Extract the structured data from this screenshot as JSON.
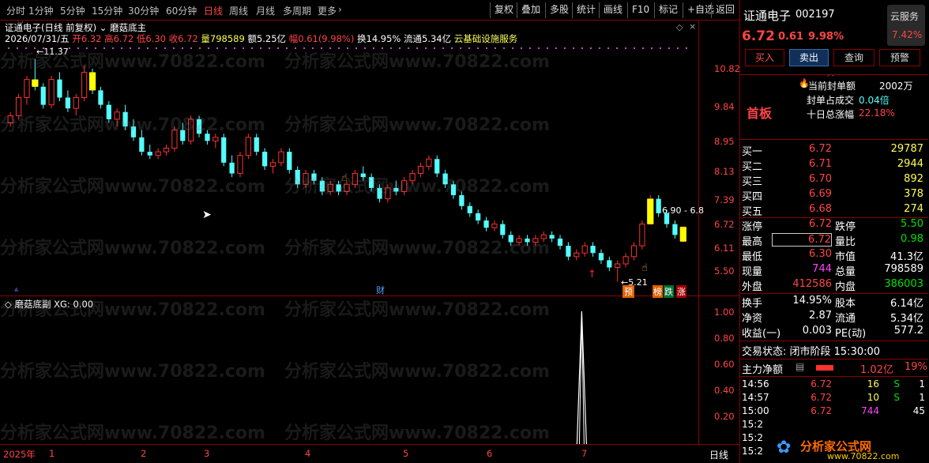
{
  "toolbar": {
    "periods": [
      "分时",
      "1分钟",
      "5分钟",
      "15分钟",
      "30分钟",
      "60分钟",
      "日线",
      "周线",
      "月线",
      "多周期",
      "更多"
    ],
    "active_period": "日线",
    "buttons": [
      "复权",
      "叠加",
      "多股",
      "统计",
      "画线",
      "F10",
      "标记",
      "+自选",
      "返回"
    ]
  },
  "main": {
    "title": "证通电子(日线 前复权)",
    "indicator": "磨菇底主",
    "date": "2026/07/31/五",
    "open_label": "开",
    "open": "6.32",
    "high_label": "高",
    "high": "6.72",
    "low_label": "低",
    "low": "6.30",
    "close_label": "收",
    "close": "6.72",
    "vol_label": "量",
    "vol": "798589",
    "amount_label": "额",
    "amount": "5.25亿",
    "range_label": "幅",
    "range": "0.61(9.98%)",
    "turnover_label": "换",
    "turnover": "14.95%",
    "float_label": "流通",
    "float": "5.34亿",
    "concept": "云基础设施服务",
    "price_ticks": [
      "10.82",
      "9.84",
      "8.95",
      "8.13",
      "7.39",
      "6.72",
      "6.11",
      "5.50"
    ],
    "high_note": "11.37",
    "low_note": "5.21",
    "last_note": "6.90 - 6.8",
    "marker_cai": "财",
    "marker_yu": "预",
    "marker_bang": "榜",
    "marker_die": "跌",
    "marker_zhang": "涨"
  },
  "sub": {
    "title": "磨菇底副",
    "xg": "XG: 0.00",
    "ticks": [
      "1.00",
      "0.80",
      "0.60",
      "0.40",
      "0.20"
    ]
  },
  "xaxis": {
    "labels": [
      "2025年",
      "1",
      "2",
      "3",
      "4",
      "5",
      "6",
      "7"
    ],
    "mode": "日线"
  },
  "watermark": "分析家公式网www.70822.com",
  "panel": {
    "name": "证通电子",
    "code": "002197",
    "cloud": "云服务",
    "cloud_pct": "7.42%",
    "price": "6.72",
    "change": "0.61",
    "pct": "9.98%",
    "btn_buy": "买入",
    "btn_sell": "卖出",
    "btn_query": "查询",
    "btn_alert": "预警",
    "board": "首板",
    "seal_label": "当前封单额",
    "seal": "2002万",
    "seal_ratio_label": "封单占成交",
    "seal_ratio": "0.04倍",
    "ten_label": "十日总涨幅",
    "ten": "22.18%",
    "bids": [
      {
        "label": "买一",
        "price": "6.72",
        "vol": "29787"
      },
      {
        "label": "买二",
        "price": "6.71",
        "vol": "2944"
      },
      {
        "label": "买三",
        "price": "6.70",
        "vol": "892"
      },
      {
        "label": "买四",
        "price": "6.69",
        "vol": "378"
      },
      {
        "label": "买五",
        "price": "6.68",
        "vol": "274"
      }
    ],
    "stats": [
      {
        "l1": "涨停",
        "v1": "6.72",
        "l2": "跌停",
        "v2": "5.50"
      },
      {
        "l1": "最高",
        "v1": "6.72",
        "l2": "量比",
        "v2": "0.98"
      },
      {
        "l1": "最低",
        "v1": "6.30",
        "l2": "市值",
        "v2": "41.3亿"
      },
      {
        "l1": "现量",
        "v1": "744",
        "l2": "总量",
        "v2": "798589"
      },
      {
        "l1": "外盘",
        "v1": "412586",
        "l2": "内盘",
        "v2": "386003"
      }
    ],
    "stats2": [
      {
        "l1": "换手",
        "v1": "14.95%",
        "l2": "股本",
        "v2": "6.14亿"
      },
      {
        "l1": "净资",
        "v1": "2.87",
        "l2": "流通",
        "v2": "5.34亿"
      },
      {
        "l1": "收益(一)",
        "v1": "0.003",
        "l2": "PE(动)",
        "v2": "577.2"
      }
    ],
    "trade_state": "交易状态: 闭市阶段 15:30:00",
    "main_net_label": "主力净额",
    "main_net": "1.02亿",
    "main_net_pct": "19%",
    "ticks": [
      {
        "time": "14:56",
        "price": "6.72",
        "vol": "16",
        "side": "S",
        "n": "1"
      },
      {
        "time": "14:57",
        "price": "6.72",
        "vol": "10",
        "side": "S",
        "n": "1"
      },
      {
        "time": "15:00",
        "price": "6.72",
        "vol": "744",
        "side": "",
        "n": "45"
      },
      {
        "time": "15:2",
        "price": "",
        "vol": "",
        "side": "",
        "n": ""
      },
      {
        "time": "15:2",
        "price": "",
        "vol": "",
        "side": "",
        "n": ""
      },
      {
        "time": "15:2",
        "price": "",
        "vol": "",
        "side": "",
        "n": ""
      }
    ],
    "logo_text": "分析家公式网",
    "logo_url": "www.70822.com"
  },
  "chart_data": {
    "type": "candlestick",
    "ylim": [
      5.0,
      11.6
    ],
    "candles": [
      [
        9.6,
        9.9,
        9.5,
        9.8
      ],
      [
        9.8,
        10.4,
        9.7,
        10.3
      ],
      [
        10.3,
        10.9,
        10.1,
        10.8
      ],
      [
        10.8,
        11.37,
        10.5,
        10.6
      ],
      [
        10.6,
        10.7,
        10.0,
        10.1
      ],
      [
        10.1,
        10.9,
        10.0,
        10.8
      ],
      [
        10.8,
        11.0,
        10.2,
        10.3
      ],
      [
        10.3,
        10.5,
        9.9,
        10.0
      ],
      [
        10.0,
        10.4,
        9.8,
        10.3
      ],
      [
        10.3,
        11.2,
        10.2,
        11.0
      ],
      [
        11.0,
        11.1,
        10.4,
        10.5
      ],
      [
        10.5,
        10.6,
        10.0,
        10.1
      ],
      [
        10.1,
        10.2,
        9.6,
        9.7
      ],
      [
        9.7,
        10.0,
        9.5,
        9.9
      ],
      [
        9.9,
        10.1,
        9.4,
        9.5
      ],
      [
        9.5,
        9.7,
        9.1,
        9.2
      ],
      [
        9.2,
        9.4,
        8.7,
        8.8
      ],
      [
        8.8,
        9.0,
        8.6,
        8.7
      ],
      [
        8.7,
        8.9,
        8.6,
        8.8
      ],
      [
        8.8,
        9.0,
        8.7,
        8.9
      ],
      [
        8.9,
        9.5,
        8.8,
        9.4
      ],
      [
        9.4,
        9.6,
        9.0,
        9.1
      ],
      [
        9.1,
        9.8,
        9.0,
        9.7
      ],
      [
        9.7,
        9.8,
        9.2,
        9.3
      ],
      [
        9.3,
        9.4,
        9.0,
        9.1
      ],
      [
        9.1,
        9.3,
        8.9,
        9.2
      ],
      [
        9.2,
        9.3,
        8.4,
        8.5
      ],
      [
        8.5,
        8.7,
        8.1,
        8.2
      ],
      [
        8.2,
        8.8,
        8.1,
        8.7
      ],
      [
        8.7,
        9.3,
        8.6,
        9.2
      ],
      [
        9.2,
        9.3,
        8.7,
        8.8
      ],
      [
        8.8,
        8.9,
        8.3,
        8.4
      ],
      [
        8.4,
        8.6,
        8.2,
        8.5
      ],
      [
        8.5,
        8.9,
        8.4,
        8.8
      ],
      [
        8.8,
        8.9,
        8.2,
        8.3
      ],
      [
        8.3,
        8.4,
        7.8,
        7.9
      ],
      [
        7.9,
        8.3,
        7.8,
        8.2
      ],
      [
        8.2,
        8.3,
        7.9,
        8.0
      ],
      [
        8.0,
        8.1,
        7.6,
        7.7
      ],
      [
        7.7,
        8.0,
        7.6,
        7.9
      ],
      [
        7.9,
        8.0,
        7.6,
        7.7
      ],
      [
        7.7,
        8.0,
        7.6,
        7.9
      ],
      [
        7.9,
        8.3,
        7.8,
        8.2
      ],
      [
        8.2,
        8.4,
        8.0,
        8.1
      ],
      [
        8.1,
        8.2,
        7.7,
        7.8
      ],
      [
        7.8,
        7.9,
        7.4,
        7.5
      ],
      [
        7.5,
        7.9,
        7.4,
        7.8
      ],
      [
        7.8,
        8.0,
        7.6,
        7.7
      ],
      [
        7.7,
        8.1,
        7.6,
        8.0
      ],
      [
        8.0,
        8.3,
        7.9,
        8.2
      ],
      [
        8.2,
        8.5,
        8.1,
        8.4
      ],
      [
        8.4,
        8.7,
        8.3,
        8.6
      ],
      [
        8.6,
        8.7,
        8.1,
        8.2
      ],
      [
        8.2,
        8.3,
        7.8,
        7.9
      ],
      [
        7.9,
        8.0,
        7.5,
        7.6
      ],
      [
        7.6,
        7.7,
        7.2,
        7.3
      ],
      [
        7.3,
        7.4,
        7.0,
        7.1
      ],
      [
        7.1,
        7.2,
        6.8,
        6.9
      ],
      [
        6.9,
        7.0,
        6.6,
        6.7
      ],
      [
        6.7,
        6.9,
        6.6,
        6.8
      ],
      [
        6.8,
        6.9,
        6.4,
        6.5
      ],
      [
        6.5,
        6.6,
        6.2,
        6.3
      ],
      [
        6.3,
        6.5,
        6.2,
        6.4
      ],
      [
        6.4,
        6.5,
        6.2,
        6.3
      ],
      [
        6.3,
        6.5,
        6.2,
        6.4
      ],
      [
        6.4,
        6.6,
        6.3,
        6.5
      ],
      [
        6.5,
        6.6,
        6.3,
        6.4
      ],
      [
        6.4,
        6.5,
        6.1,
        6.2
      ],
      [
        6.2,
        6.3,
        5.8,
        5.9
      ],
      [
        5.9,
        6.1,
        5.8,
        6.0
      ],
      [
        6.0,
        6.3,
        5.9,
        6.2
      ],
      [
        6.2,
        6.3,
        5.9,
        6.0
      ],
      [
        6.0,
        6.1,
        5.7,
        5.8
      ],
      [
        5.8,
        5.9,
        5.5,
        5.6
      ],
      [
        5.6,
        5.8,
        5.21,
        5.7
      ],
      [
        5.7,
        6.0,
        5.6,
        5.9
      ],
      [
        5.9,
        6.3,
        5.8,
        6.2
      ],
      [
        6.2,
        6.9,
        6.1,
        6.8
      ],
      [
        6.8,
        7.6,
        6.8,
        7.5
      ],
      [
        7.5,
        7.6,
        7.0,
        7.1
      ],
      [
        7.1,
        7.2,
        6.7,
        6.8
      ],
      [
        6.8,
        6.9,
        6.4,
        6.5
      ],
      [
        6.32,
        6.72,
        6.3,
        6.72
      ]
    ],
    "signal": {
      "index_fraction": 0.845,
      "value": 1.0
    }
  }
}
